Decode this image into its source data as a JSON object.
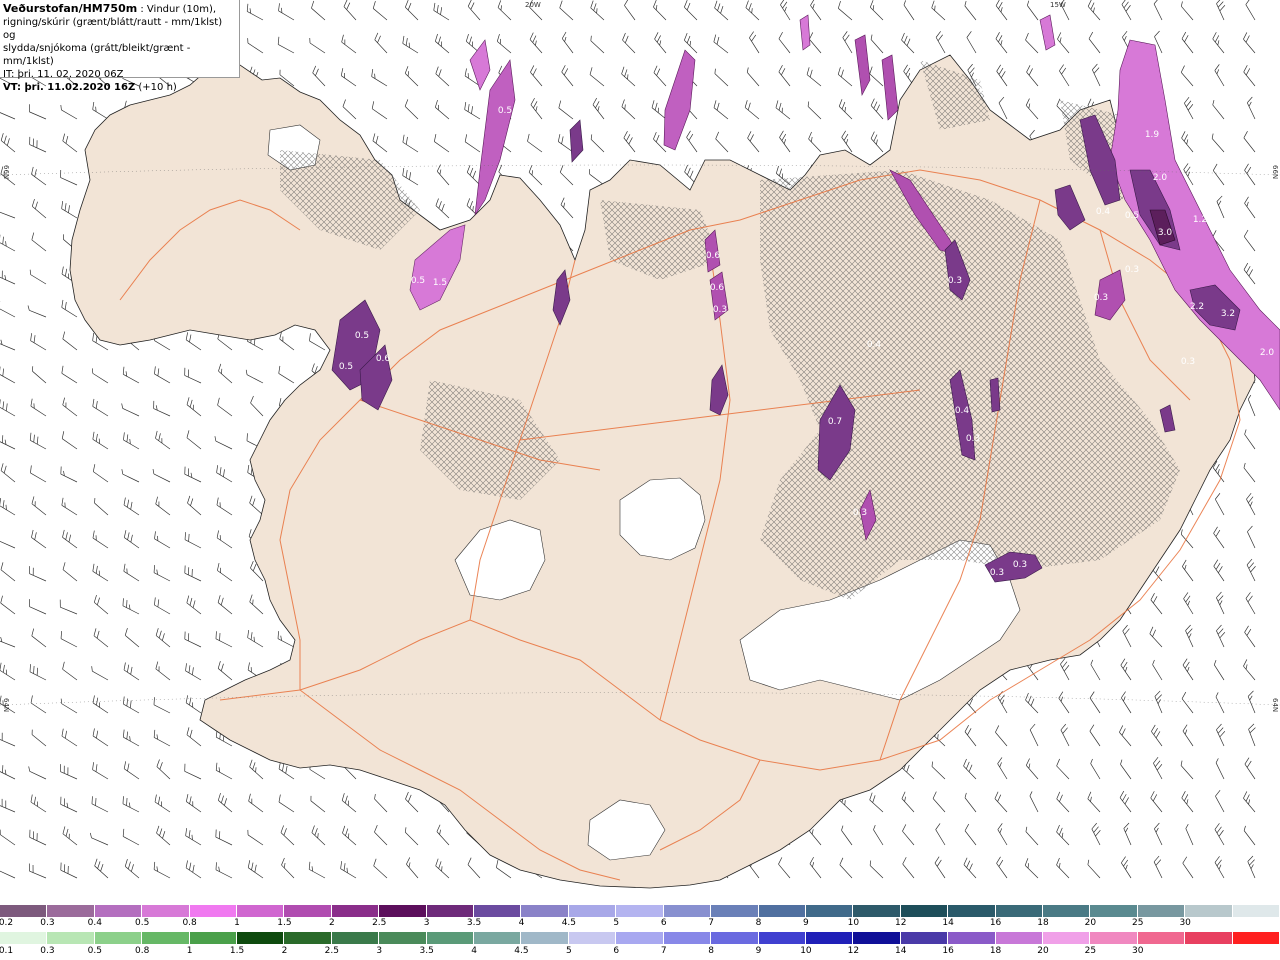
{
  "info": {
    "title": "Veðurstofan/HM750m",
    "title_suffix": " : Vindur (10m),",
    "line2": "rigning/skúrir (grænt/blátt/rautt - mm/1klst) og",
    "line3": "slydda/snjókoma (grátt/bleikt/grænt - mm/1klst)",
    "line4": "IT: þri. 11. 02. 2020 06Z",
    "line5_bold": "VT: þri. 11.02.2020 16Z",
    "line5_rest": " (+10 h)"
  },
  "edge_labels": {
    "top_left": "20W",
    "top_right": "15W",
    "left_upper": "66N",
    "left_lower": "64N",
    "right_upper": "66N",
    "right_lower": "64N"
  },
  "colors": {
    "land": "#f2e4d6",
    "road": "#e8703a",
    "sea": "#ffffff",
    "ice": "#ffffff"
  },
  "precip_labels": [
    {
      "text": "0.5"
    },
    {
      "text": "1.5"
    },
    {
      "text": "0.5"
    },
    {
      "text": "0.5"
    },
    {
      "text": "0.6"
    },
    {
      "text": "0.6"
    },
    {
      "text": "0.6"
    },
    {
      "text": "0.3"
    },
    {
      "text": "0.7"
    },
    {
      "text": "0.4"
    },
    {
      "text": "0.4"
    },
    {
      "text": "0.3"
    },
    {
      "text": "0.3"
    },
    {
      "text": "0.3"
    },
    {
      "text": "0.8"
    },
    {
      "text": "1.9"
    },
    {
      "text": "2.0"
    },
    {
      "text": "0.5"
    },
    {
      "text": "3.0"
    },
    {
      "text": "1.2"
    },
    {
      "text": "0.3"
    },
    {
      "text": "2.2"
    },
    {
      "text": "3.2"
    },
    {
      "text": "2.0"
    },
    {
      "text": "0.3"
    },
    {
      "text": "0.4"
    },
    {
      "text": "0.3"
    },
    {
      "text": "0.3"
    },
    {
      "text": "0.3"
    },
    {
      "text": "0.5"
    }
  ],
  "legend": {
    "row1_colors": [
      "#7d5a7d",
      "#9b6b9b",
      "#b46fbf",
      "#d779d7",
      "#f079f0",
      "#d066d0",
      "#b04cb0",
      "#8a2e8a",
      "#5c0f5c",
      "#6e2a7a",
      "#6b4ba0",
      "#8a82c8",
      "#a8a8e8",
      "#b4b4f0",
      "#8890d0",
      "#6a80b8",
      "#5070a0",
      "#406a8a",
      "#2e5a6a",
      "#1e4e5a",
      "#2a5a6a",
      "#3a6a78",
      "#4a7a85",
      "#5a8a90",
      "#7898a0",
      "#b8c8cc",
      "#dfe8ea"
    ],
    "row1_labels": [
      "0.2",
      "0.3",
      "0.4",
      "0.5",
      "0.8",
      "1",
      "1.5",
      "2",
      "2.5",
      "3",
      "3.5",
      "4",
      "4.5",
      "5",
      "6",
      "7",
      "8",
      "9",
      "10",
      "12",
      "14",
      "16",
      "18",
      "20",
      "25",
      "30"
    ],
    "row2_colors": [
      "#e0f5e0",
      "#b8e6b4",
      "#8cd08a",
      "#66b866",
      "#4aa04a",
      "#0e4a0e",
      "#2a6a2a",
      "#3a7a4a",
      "#4a8a5a",
      "#5a9a78",
      "#7aa8a0",
      "#a0b8c8",
      "#c8c8f0",
      "#a8a8f0",
      "#8888e8",
      "#6a6ae0",
      "#4040d0",
      "#2020b8",
      "#101098",
      "#4a3aa8",
      "#8a5ac8",
      "#c878d8",
      "#f0a0e8",
      "#f088c0",
      "#f06890",
      "#e84060",
      "#ff2020"
    ],
    "row2_labels": [
      "0.1",
      "0.3",
      "0.5",
      "0.8",
      "1",
      "1.5",
      "2",
      "2.5",
      "3",
      "3.5",
      "4",
      "4.5",
      "5",
      "6",
      "7",
      "8",
      "9",
      "10",
      "12",
      "14",
      "16",
      "18",
      "20",
      "25",
      "30"
    ]
  }
}
